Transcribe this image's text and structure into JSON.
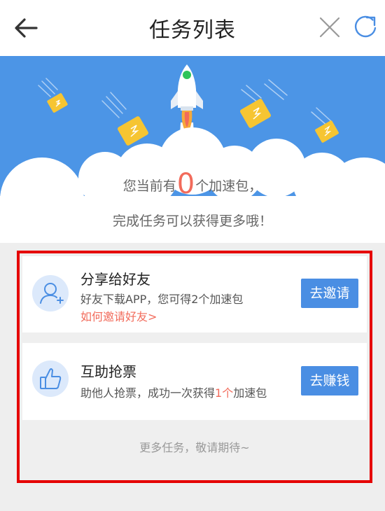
{
  "header": {
    "title": "任务列表",
    "back_icon": "arrow-left-icon",
    "close_icon": "close-icon",
    "refresh_icon": "refresh-icon"
  },
  "banner": {
    "line1_prefix": "您当前有",
    "count": "0",
    "line1_suffix": "个加速包，",
    "line2": "完成任务可以获得更多哦！",
    "background_color": "#4c95e6",
    "count_color": "#f26b5b"
  },
  "tasks": [
    {
      "title": "分享给好友",
      "desc": "好友下载APP，您可得2个加速包",
      "link": "如何邀请好友>",
      "button": "去邀请",
      "icon": "add-user-icon"
    },
    {
      "title": "互助抢票",
      "desc_prefix": "助他人抢票，成功一次获得",
      "desc_highlight": "1个",
      "desc_suffix": "加速包",
      "button": "去赚钱",
      "icon": "thumbs-up-icon"
    }
  ],
  "more_tasks": "更多任务，敬请期待~",
  "colors": {
    "accent": "#4a8ee3",
    "highlight": "#f26b5b",
    "highlight_border": "#e50000"
  }
}
